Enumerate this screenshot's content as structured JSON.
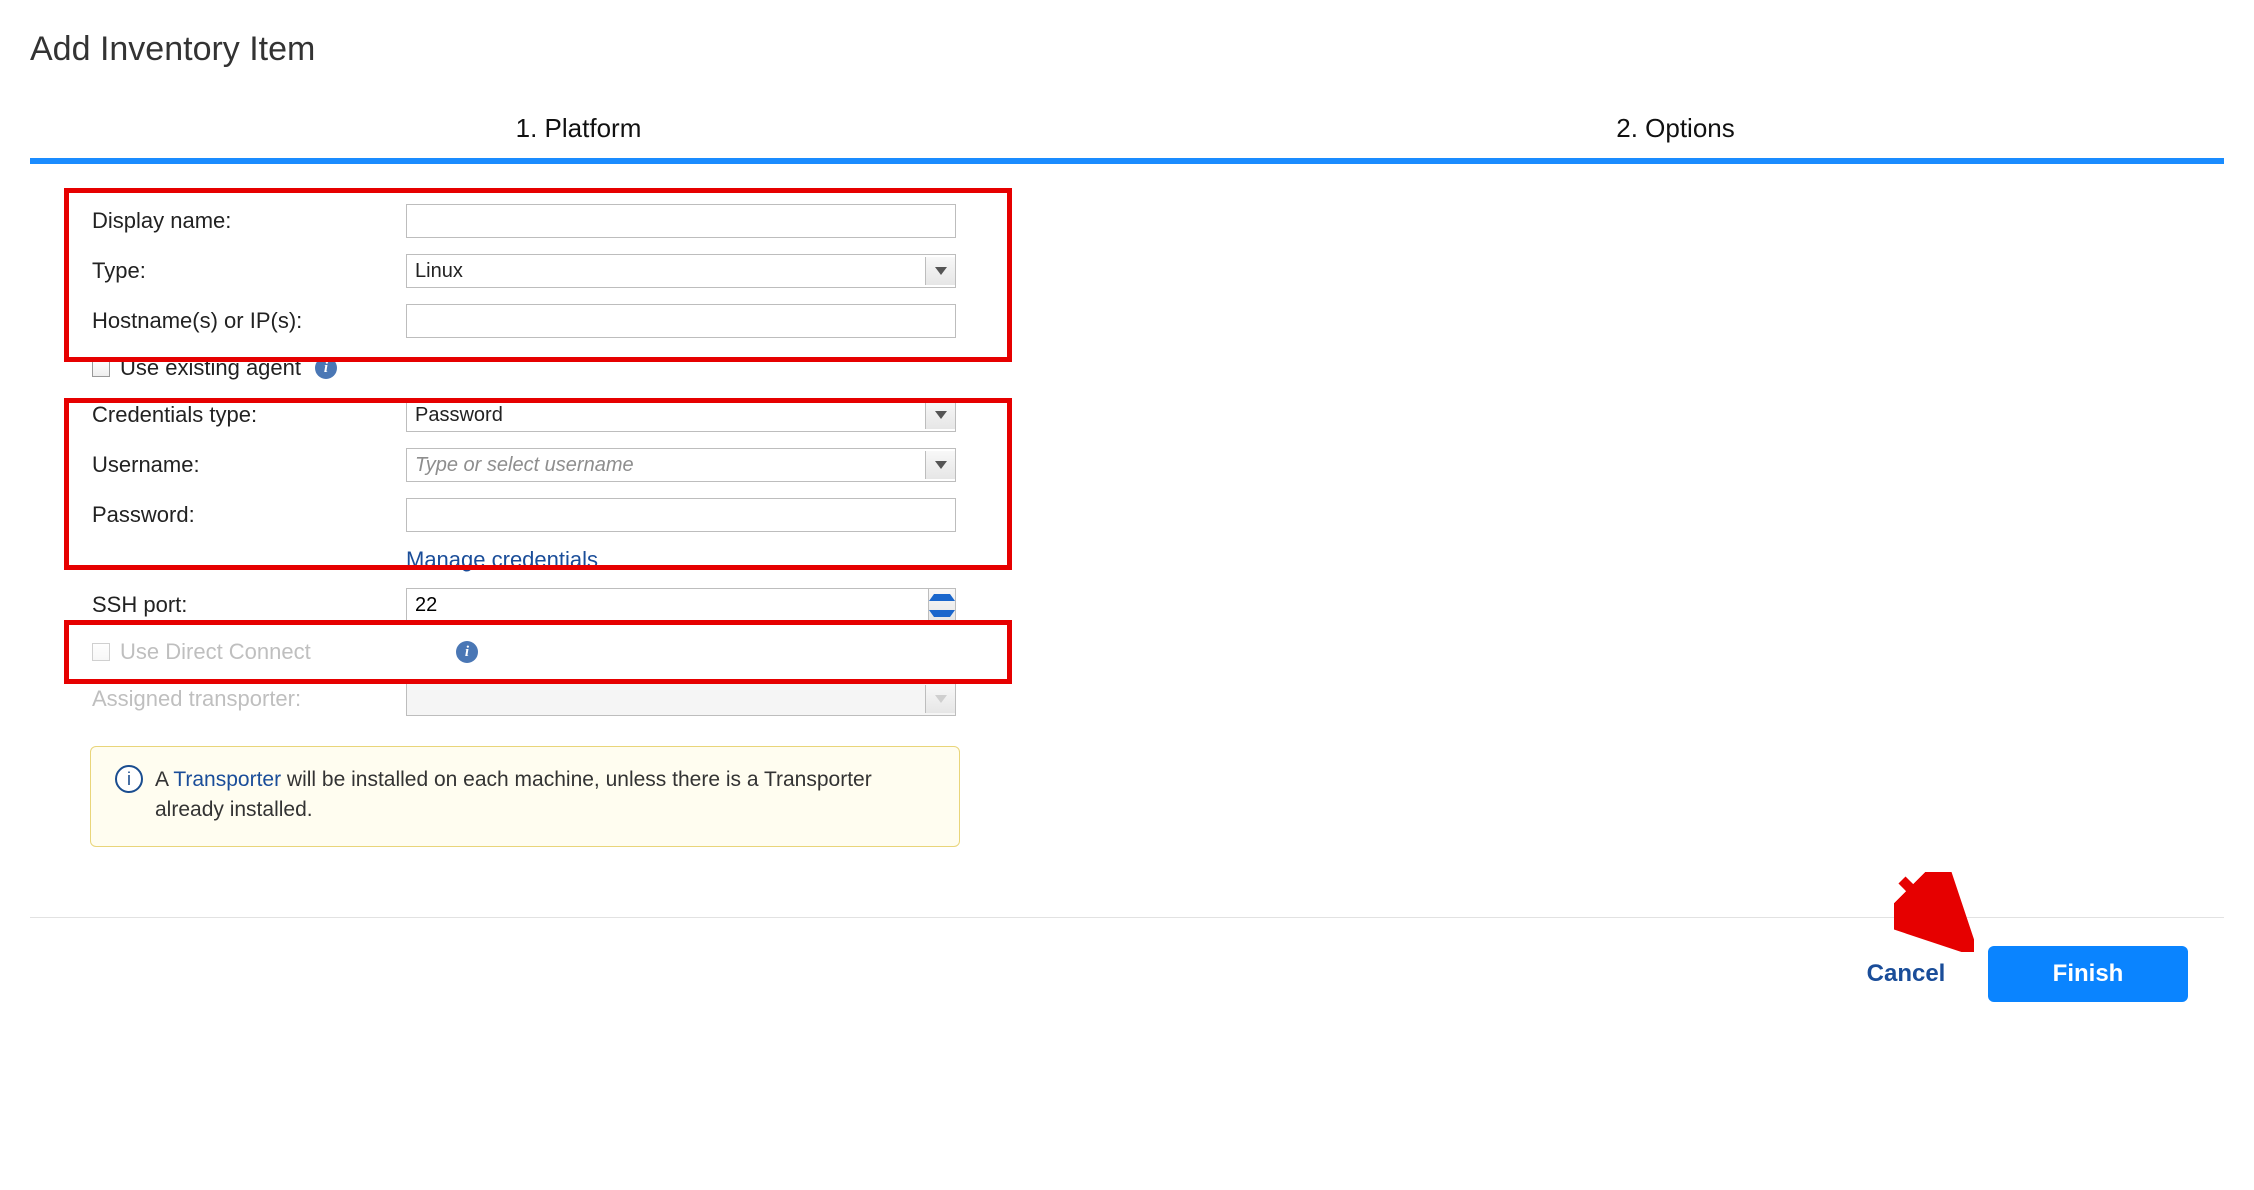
{
  "title": "Add Inventory Item",
  "steps": {
    "one": "1. Platform",
    "two": "2. Options"
  },
  "form": {
    "display_name": {
      "label": "Display name:",
      "value": ""
    },
    "type": {
      "label": "Type:",
      "value": "Linux"
    },
    "hostnames": {
      "label": "Hostname(s) or IP(s):",
      "value": ""
    },
    "use_existing_agent": {
      "label": "Use existing agent",
      "checked": false
    },
    "credentials_type": {
      "label": "Credentials type:",
      "value": "Password"
    },
    "username": {
      "label": "Username:",
      "placeholder": "Type or select username",
      "value": ""
    },
    "password": {
      "label": "Password:",
      "value": ""
    },
    "manage_credentials": "Manage credentials",
    "ssh_port": {
      "label": "SSH port:",
      "value": "22"
    },
    "use_direct_connect": {
      "label": "Use Direct Connect",
      "checked": false,
      "disabled": true
    },
    "assigned_transporter": {
      "label": "Assigned transporter:",
      "value": "",
      "disabled": true
    }
  },
  "note": {
    "prefix": "A ",
    "link": "Transporter",
    "rest": " will be installed on each machine, unless there is a Transporter already installed."
  },
  "footer": {
    "cancel": "Cancel",
    "finish": "Finish"
  }
}
